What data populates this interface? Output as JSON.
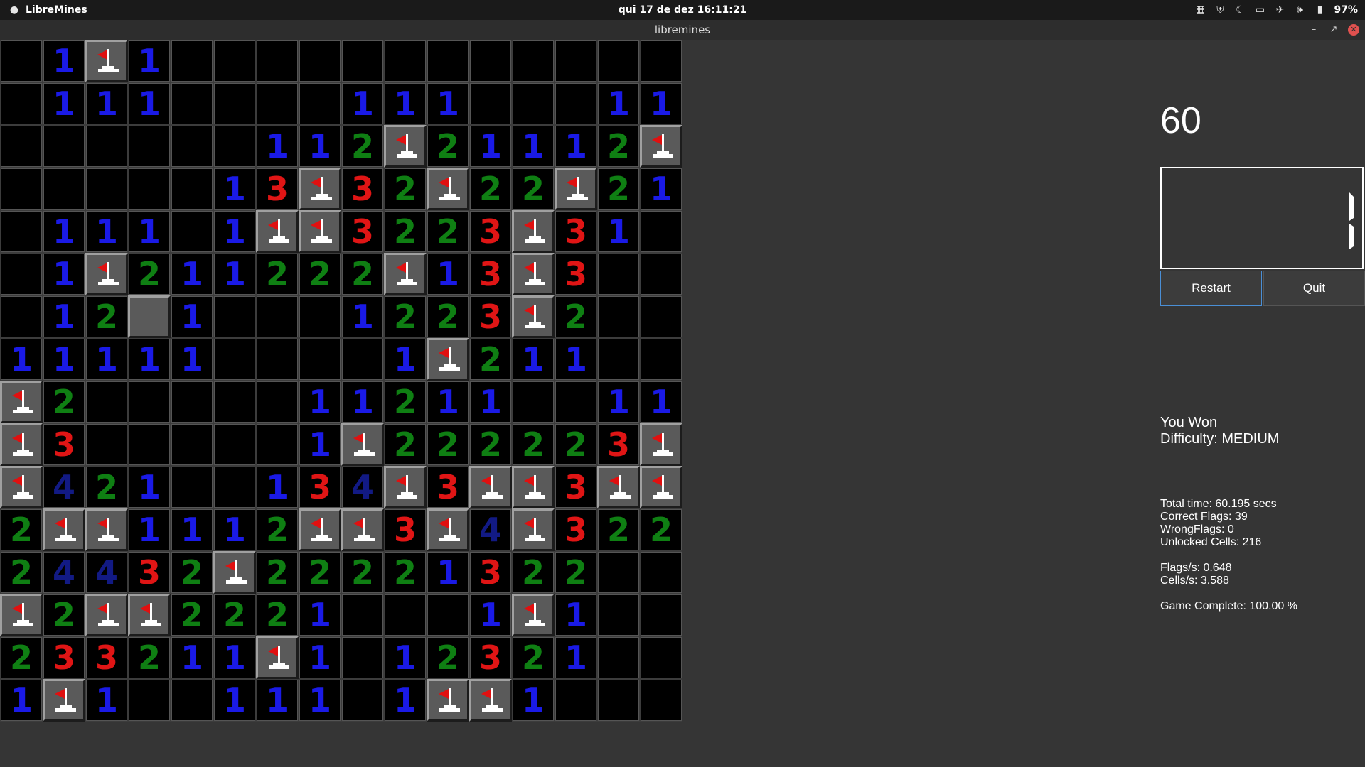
{
  "topbar": {
    "app_name": "LibreMines",
    "clock": "qui 17 de dez  16:11:21",
    "battery": "97%"
  },
  "window": {
    "title": "libremines"
  },
  "board": {
    "rows": [
      [
        ".",
        "1",
        "F",
        "1",
        ".",
        ".",
        ".",
        ".",
        ".",
        ".",
        ".",
        ".",
        ".",
        ".",
        ".",
        "."
      ],
      [
        ".",
        "1",
        "1",
        "1",
        ".",
        ".",
        ".",
        ".",
        "1",
        "1",
        "1",
        ".",
        ".",
        ".",
        "1",
        "1"
      ],
      [
        ".",
        ".",
        ".",
        ".",
        ".",
        ".",
        "1",
        "1",
        "2",
        "F",
        "2",
        "1",
        "1",
        "1",
        "2",
        "F"
      ],
      [
        ".",
        ".",
        ".",
        ".",
        ".",
        "1",
        "3",
        "F",
        "3",
        "2",
        "F",
        "2",
        "2",
        "F",
        "2",
        "1"
      ],
      [
        ".",
        "1",
        "1",
        "1",
        ".",
        "1",
        "F",
        "F",
        "3",
        "2",
        "2",
        "3",
        "F",
        "3",
        "1",
        "."
      ],
      [
        ".",
        "1",
        "F",
        "2",
        "1",
        "1",
        "2",
        "2",
        "2",
        "F",
        "1",
        "3",
        "F",
        "3",
        ".",
        "."
      ],
      [
        ".",
        "1",
        "2",
        "H",
        "1",
        ".",
        ".",
        ".",
        "1",
        "2",
        "2",
        "3",
        "F",
        "2",
        ".",
        "."
      ],
      [
        "1",
        "1",
        "1",
        "1",
        "1",
        ".",
        ".",
        ".",
        ".",
        "1",
        "F",
        "2",
        "1",
        "1",
        ".",
        "."
      ],
      [
        "F",
        "2",
        ".",
        ".",
        ".",
        ".",
        ".",
        "1",
        "1",
        "2",
        "1",
        "1",
        ".",
        ".",
        "1",
        "1"
      ],
      [
        "F",
        "3",
        ".",
        ".",
        ".",
        ".",
        ".",
        "1",
        "F",
        "2",
        "2",
        "2",
        "2",
        "2",
        "3",
        "F"
      ],
      [
        "F",
        "4",
        "2",
        "1",
        ".",
        ".",
        "1",
        "3",
        "4",
        "F",
        "3",
        "F",
        "F",
        "3",
        "F",
        "F"
      ],
      [
        "2",
        "F",
        "F",
        "1",
        "1",
        "1",
        "2",
        "F",
        "F",
        "3",
        "F",
        "4",
        "F",
        "3",
        "2",
        "2"
      ],
      [
        "2",
        "4",
        "4",
        "3",
        "2",
        "F",
        "2",
        "2",
        "2",
        "2",
        "1",
        "3",
        "2",
        "2",
        ".",
        "."
      ],
      [
        "F",
        "2",
        "F",
        "F",
        "2",
        "2",
        "2",
        "1",
        ".",
        ".",
        ".",
        "1",
        "F",
        "1",
        ".",
        "."
      ],
      [
        "2",
        "3",
        "3",
        "2",
        "1",
        "1",
        "F",
        "1",
        ".",
        "1",
        "2",
        "3",
        "2",
        "1",
        ".",
        "."
      ],
      [
        "1",
        "F",
        "1",
        ".",
        ".",
        "1",
        "1",
        "1",
        ".",
        "1",
        "F",
        "F",
        "1",
        ".",
        ".",
        "."
      ]
    ]
  },
  "mine_counter": "60",
  "buttons": {
    "restart": "Restart",
    "quit": "Quit"
  },
  "status": {
    "result": "You Won",
    "difficulty": "Difficulty: MEDIUM"
  },
  "stats": {
    "total_time": "Total time: 60.195 secs",
    "correct_flags": "Correct Flags: 39",
    "wrong_flags": "WrongFlags: 0",
    "unlocked_cells": "Unlocked Cells: 216",
    "flags_per_sec": "Flags/s: 0.648",
    "cells_per_sec": "Cells/s: 3.588",
    "game_complete": "Game Complete: 100.00 %"
  },
  "icons": {
    "app": "mine-icon",
    "tray": [
      "grid-icon",
      "shield-icon",
      "moon-icon",
      "screen-icon",
      "airplane-icon",
      "volume-icon",
      "battery-icon"
    ],
    "window": [
      "minimize-icon",
      "maximize-icon",
      "close-icon"
    ]
  },
  "colors": {
    "number_1": "#1a1ae6",
    "number_2": "#0f7f13",
    "number_3": "#e01515",
    "number_4": "#121a84",
    "flag": "#e01010"
  }
}
